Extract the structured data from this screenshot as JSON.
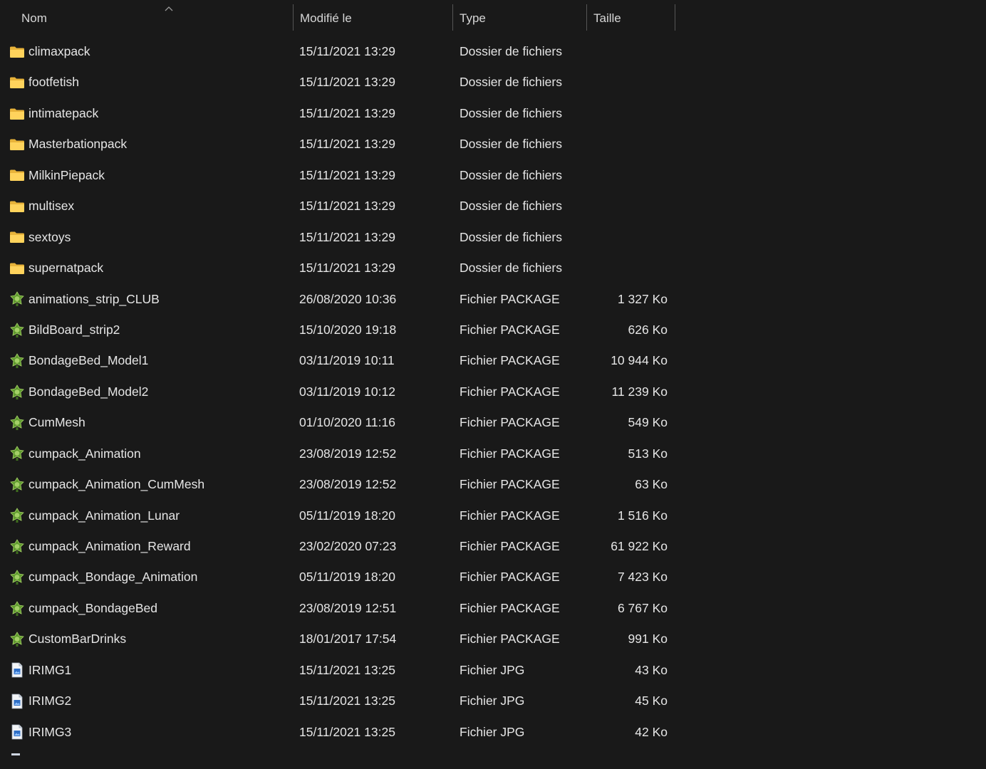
{
  "columns": {
    "name": "Nom",
    "modified": "Modifié le",
    "type": "Type",
    "size": "Taille"
  },
  "sort": {
    "column": "name",
    "direction": "ascending",
    "icon": "chevron-up-icon"
  },
  "colors": {
    "background": "#191919",
    "text": "#e6e6e6",
    "folder": "#f5c542",
    "package": "#6ea33a",
    "jpg": "#3b7fd1"
  },
  "rows": [
    {
      "icon": "folder-icon",
      "name": "climaxpack",
      "date": "15/11/2021 13:29",
      "type": "Dossier de fichiers",
      "size": ""
    },
    {
      "icon": "folder-icon",
      "name": "footfetish",
      "date": "15/11/2021 13:29",
      "type": "Dossier de fichiers",
      "size": ""
    },
    {
      "icon": "folder-icon",
      "name": "intimatepack",
      "date": "15/11/2021 13:29",
      "type": "Dossier de fichiers",
      "size": ""
    },
    {
      "icon": "folder-icon",
      "name": "Masterbationpack",
      "date": "15/11/2021 13:29",
      "type": "Dossier de fichiers",
      "size": ""
    },
    {
      "icon": "folder-icon",
      "name": "MilkinPiepack",
      "date": "15/11/2021 13:29",
      "type": "Dossier de fichiers",
      "size": ""
    },
    {
      "icon": "folder-icon",
      "name": "multisex",
      "date": "15/11/2021 13:29",
      "type": "Dossier de fichiers",
      "size": ""
    },
    {
      "icon": "folder-icon",
      "name": "sextoys",
      "date": "15/11/2021 13:29",
      "type": "Dossier de fichiers",
      "size": ""
    },
    {
      "icon": "folder-icon",
      "name": "supernatpack",
      "date": "15/11/2021 13:29",
      "type": "Dossier de fichiers",
      "size": ""
    },
    {
      "icon": "package-icon",
      "name": "animations_strip_CLUB",
      "date": "26/08/2020 10:36",
      "type": "Fichier PACKAGE",
      "size": "1 327 Ko"
    },
    {
      "icon": "package-icon",
      "name": "BildBoard_strip2",
      "date": "15/10/2020 19:18",
      "type": "Fichier PACKAGE",
      "size": "626 Ko"
    },
    {
      "icon": "package-icon",
      "name": "BondageBed_Model1",
      "date": "03/11/2019 10:11",
      "type": "Fichier PACKAGE",
      "size": "10 944 Ko"
    },
    {
      "icon": "package-icon",
      "name": "BondageBed_Model2",
      "date": "03/11/2019 10:12",
      "type": "Fichier PACKAGE",
      "size": "11 239 Ko"
    },
    {
      "icon": "package-icon",
      "name": "CumMesh",
      "date": "01/10/2020 11:16",
      "type": "Fichier PACKAGE",
      "size": "549 Ko"
    },
    {
      "icon": "package-icon",
      "name": "cumpack_Animation",
      "date": "23/08/2019 12:52",
      "type": "Fichier PACKAGE",
      "size": "513 Ko"
    },
    {
      "icon": "package-icon",
      "name": "cumpack_Animation_CumMesh",
      "date": "23/08/2019 12:52",
      "type": "Fichier PACKAGE",
      "size": "63 Ko"
    },
    {
      "icon": "package-icon",
      "name": "cumpack_Animation_Lunar",
      "date": "05/11/2019 18:20",
      "type": "Fichier PACKAGE",
      "size": "1 516 Ko"
    },
    {
      "icon": "package-icon",
      "name": "cumpack_Animation_Reward",
      "date": "23/02/2020 07:23",
      "type": "Fichier PACKAGE",
      "size": "61 922 Ko"
    },
    {
      "icon": "package-icon",
      "name": "cumpack_Bondage_Animation",
      "date": "05/11/2019 18:20",
      "type": "Fichier PACKAGE",
      "size": "7 423 Ko"
    },
    {
      "icon": "package-icon",
      "name": "cumpack_BondageBed",
      "date": "23/08/2019 12:51",
      "type": "Fichier PACKAGE",
      "size": "6 767 Ko"
    },
    {
      "icon": "package-icon",
      "name": "CustomBarDrinks",
      "date": "18/01/2017 17:54",
      "type": "Fichier PACKAGE",
      "size": "991 Ko"
    },
    {
      "icon": "jpg-file-icon",
      "name": "IRIMG1",
      "date": "15/11/2021 13:25",
      "type": "Fichier JPG",
      "size": "43 Ko"
    },
    {
      "icon": "jpg-file-icon",
      "name": "IRIMG2",
      "date": "15/11/2021 13:25",
      "type": "Fichier JPG",
      "size": "45 Ko"
    },
    {
      "icon": "jpg-file-icon",
      "name": "IRIMG3",
      "date": "15/11/2021 13:25",
      "type": "Fichier JPG",
      "size": "42 Ko"
    }
  ]
}
